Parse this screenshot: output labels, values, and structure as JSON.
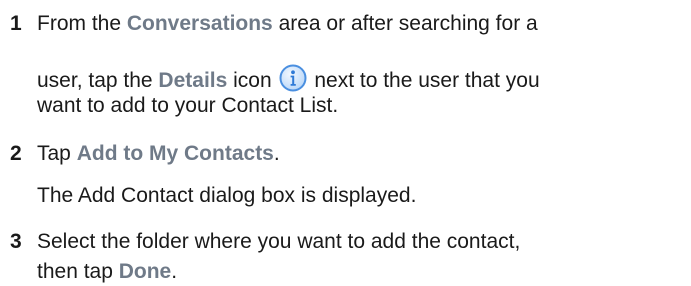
{
  "steps": [
    {
      "number": "1",
      "line1": {
        "pre": "From the ",
        "ui1": "Conversations",
        "post": " area or after searching for a"
      },
      "line2": {
        "pre": "user, tap the ",
        "ui1": "Details",
        "mid": " icon ",
        "post": " next to the user that you"
      },
      "line3": "want to add to your Contact List."
    },
    {
      "number": "2",
      "line1": {
        "pre": "Tap ",
        "ui1": "Add to My Contacts",
        "post": "."
      },
      "line2": "The Add Contact dialog box is displayed."
    },
    {
      "number": "3",
      "line1": "Select the folder where you want to add the contact,",
      "line2": {
        "pre": "then tap ",
        "ui1": "Done",
        "post": "."
      }
    }
  ],
  "icons": {
    "details": "info-circle-icon"
  },
  "colors": {
    "text": "#1a1a1a",
    "ui_term": "#6f7a88",
    "icon_fill": "#cfe3fb",
    "icon_stroke": "#4a8fe0"
  }
}
